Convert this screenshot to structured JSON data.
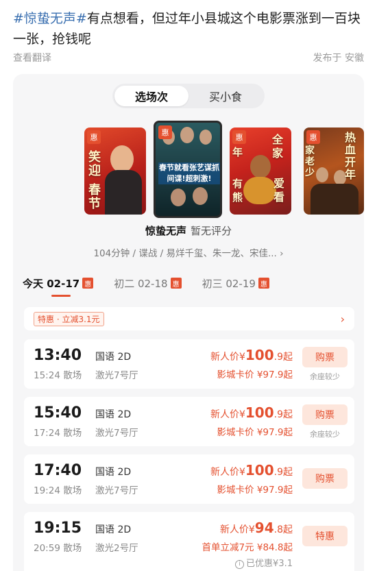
{
  "post": {
    "hashtag": "#惊蛰无声#",
    "text": "有点想看，但过年小县城这个电影票涨到一百块一张，抢钱呢",
    "translate_link": "查看翻译",
    "published": "发布于 安徽"
  },
  "app": {
    "tabs": [
      {
        "label": "选场次",
        "active": true
      },
      {
        "label": "买小食",
        "active": false
      }
    ],
    "posters": [
      {
        "badge": "惠",
        "text_a": "笑迎",
        "text_b": "春节"
      },
      {
        "badge": "惠",
        "caption": "春节就看张艺谋抓间谍!超刺激!"
      },
      {
        "badge": "惠",
        "text_a": "全家",
        "text_b": "爱看",
        "text_c": "年",
        "text_d": "有熊"
      },
      {
        "badge": "惠",
        "text_a": "热血开年",
        "text_b": "家老少"
      }
    ],
    "movie": {
      "name": "惊蛰无声",
      "score": "暂无评分",
      "info": "104分钟 / 谍战 / 易烊千玺、朱一龙、宋佳..."
    },
    "dates": [
      {
        "label": "今天 02-17",
        "badge": "惠",
        "active": true
      },
      {
        "label": "初二 02-18",
        "badge": "惠",
        "active": false
      },
      {
        "label": "初三 02-19",
        "badge": "惠",
        "active": false
      }
    ],
    "promo": {
      "label": "特惠 · 立减3.1元",
      "arrow": "›"
    },
    "showtimes": [
      {
        "start": "13:40",
        "end": "15:24 散场",
        "lang": "国语 2D",
        "hall": "激光7号厅",
        "price_label": "新人价¥",
        "price_big": "100",
        "price_small": ".9起",
        "price2": "影城卡价 ¥97.9起",
        "button": "购票",
        "seats": "余座较少"
      },
      {
        "start": "15:40",
        "end": "17:24 散场",
        "lang": "国语 2D",
        "hall": "激光7号厅",
        "price_label": "新人价¥",
        "price_big": "100",
        "price_small": ".9起",
        "price2": "影城卡价 ¥97.9起",
        "button": "购票",
        "seats": "余座较少"
      },
      {
        "start": "17:40",
        "end": "19:24 散场",
        "lang": "国语 2D",
        "hall": "激光7号厅",
        "price_label": "新人价¥",
        "price_big": "100",
        "price_small": ".9起",
        "price2": "影城卡价 ¥97.9起",
        "button": "购票",
        "seats": ""
      },
      {
        "start": "19:15",
        "end": "20:59 散场",
        "lang": "国语 2D",
        "hall": "激光2号厅",
        "price_label": "新人价¥",
        "price_big": "94",
        "price_small": ".8起",
        "price2": "首单立减7元 ¥84.8起",
        "button": "特惠",
        "seats": "",
        "discount": "已优惠¥3.1"
      }
    ]
  },
  "colors": {
    "accent": "#e4502f",
    "hashtag": "#3a6fb0",
    "button_bg": "#fde6dc"
  }
}
